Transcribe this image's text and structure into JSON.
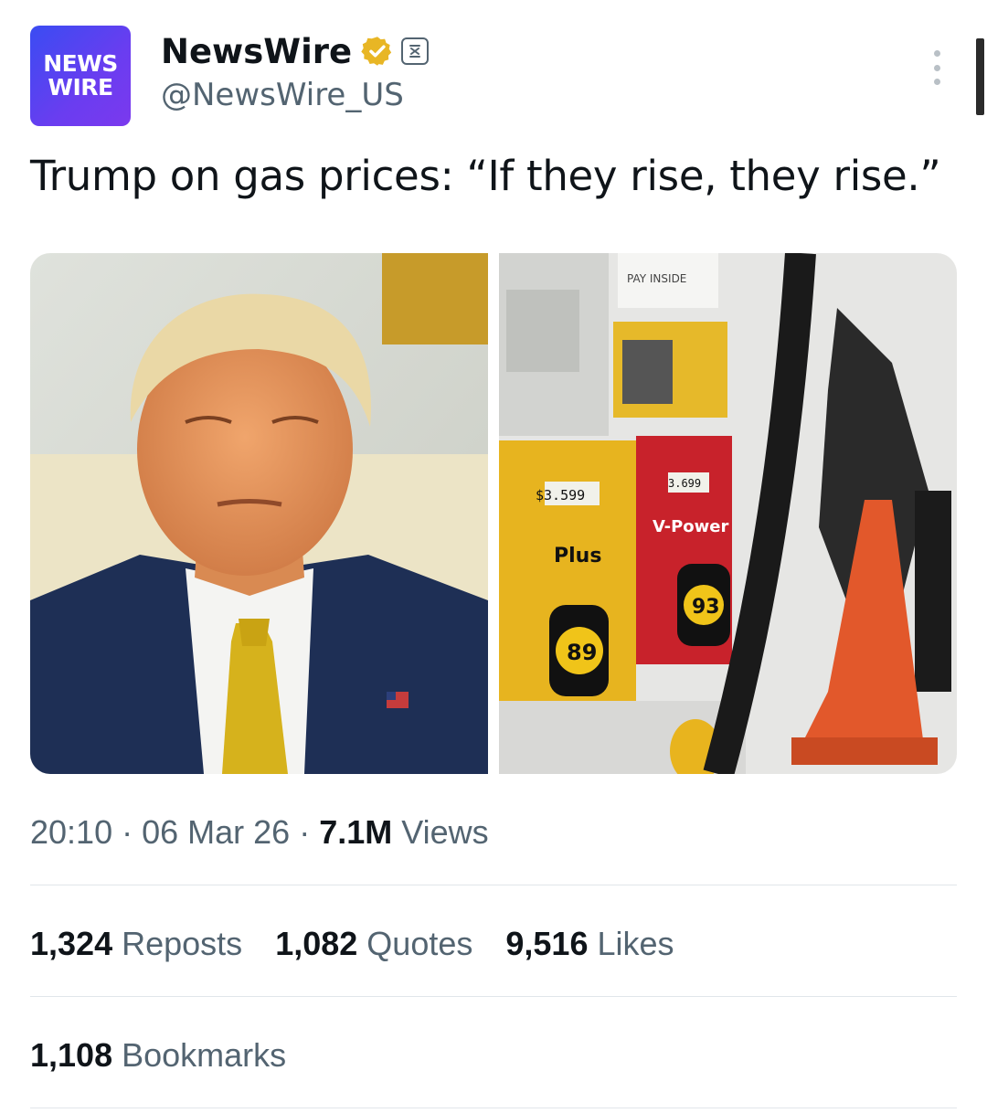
{
  "account": {
    "avatar_line1": "NEWS",
    "avatar_line2": "WIRE",
    "display_name": "NewsWire",
    "handle": "@NewsWire_US",
    "verified_icon": "gold-verified-badge-icon",
    "affiliation_icon": "affiliate-badge-icon",
    "brand_color": "#5a40f0",
    "verified_color": "#e8b625"
  },
  "tweet": {
    "text": "Trump on gas prices: “If they rise, they rise.”"
  },
  "media": {
    "photo_left": {
      "name": "portrait-photo",
      "tie_color": "#d6b21c",
      "suit_color": "#1e2f55"
    },
    "photo_right": {
      "name": "gas-pump-photo",
      "price_plus": "$3.599",
      "price_vpower": "3.699",
      "grade_plus": "Plus",
      "grade_vpower": "V-Power",
      "octane_plus": "89",
      "octane_vpower": "93",
      "sign_text": "PAY INSIDE"
    }
  },
  "meta": {
    "time": "20:10",
    "date": "06 Mar 26",
    "views_count": "7.1M",
    "views_label": "Views"
  },
  "stats": {
    "reposts_count": "1,324",
    "reposts_label": "Reposts",
    "quotes_count": "1,082",
    "quotes_label": "Quotes",
    "likes_count": "9,516",
    "likes_label": "Likes",
    "bookmarks_count": "1,108",
    "bookmarks_label": "Bookmarks"
  }
}
